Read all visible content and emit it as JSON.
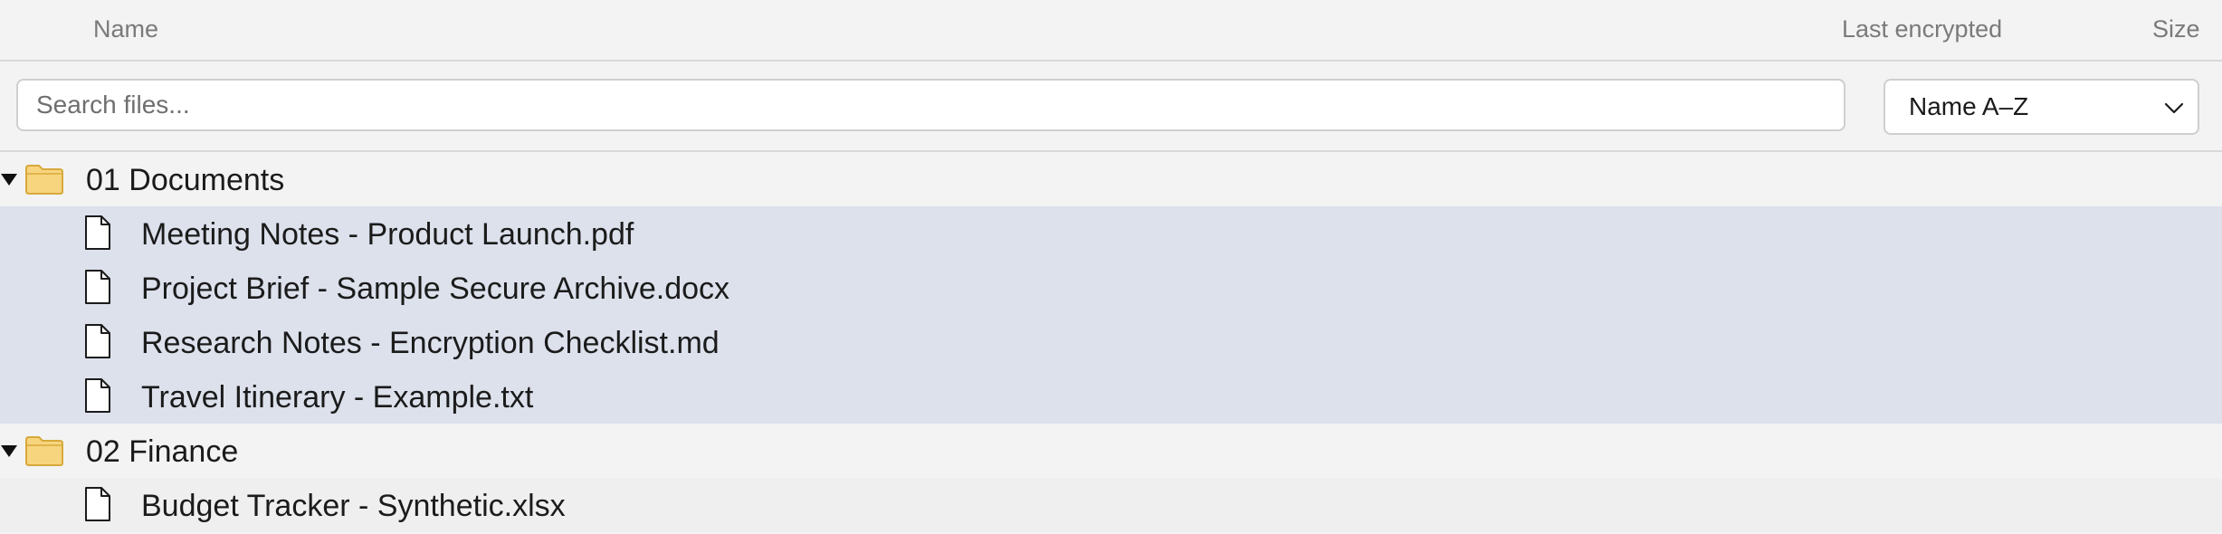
{
  "columns": {
    "name": "Name",
    "last_encrypted": "Last encrypted",
    "size": "Size"
  },
  "search": {
    "placeholder": "Search files...",
    "value": ""
  },
  "sort": {
    "selected": "Name A–Z"
  },
  "tree": {
    "folders": [
      {
        "label": "01 Documents",
        "expanded": true,
        "files": [
          {
            "label": "Meeting Notes - Product Launch.pdf",
            "selected": true
          },
          {
            "label": "Project Brief - Sample Secure Archive.docx",
            "selected": true
          },
          {
            "label": "Research Notes - Encryption Checklist.md",
            "selected": true
          },
          {
            "label": "Travel Itinerary - Example.txt",
            "selected": true
          }
        ]
      },
      {
        "label": "02 Finance",
        "expanded": true,
        "files": [
          {
            "label": "Budget Tracker - Synthetic.xlsx",
            "selected": false
          }
        ]
      }
    ]
  },
  "colors": {
    "selected_row": "#dce1ec",
    "folder_fill": "#f7d57e",
    "folder_stroke": "#d8a93c"
  },
  "icons": {
    "twisty": "triangle-down-icon",
    "folder": "folder-icon",
    "file": "file-icon",
    "chevron": "chevron-down-icon"
  }
}
